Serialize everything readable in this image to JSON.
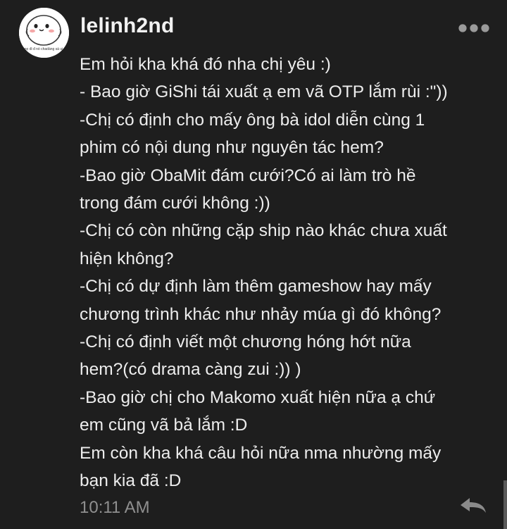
{
  "post": {
    "username": "lelinh2nd",
    "avatar_caption": "nọ đi đ nó chadàng sá ui",
    "icons": {
      "more": "more-options-icon",
      "reply": "reply-arrow-icon"
    },
    "message_lines": [
      "Em hỏi kha khá đó nha chị yêu :)",
      "- Bao giờ GiShi tái xuất ạ em vã OTP lắm rùi :\"))",
      "-Chị có định cho mấy ông bà idol diễn cùng 1",
      "phim có nội dung như nguyên tác hem?",
      "-Bao giờ ObaMit đám cưới?Có ai làm trò hề",
      "trong đám cưới không :))",
      "-Chị có còn những cặp ship nào khác chưa xuất",
      "hiện không?",
      "-Chị có dự định làm thêm gameshow hay mấy",
      "chương trình khác như nhảy múa gì đó không?",
      "-Chị có định viết một chương hóng hớt nữa",
      "hem?(có drama càng zui :)) )",
      "-Bao giờ chị cho Makomo xuất hiện nữa ạ chứ",
      "em cũng vã bả lắm :D",
      "Em còn kha khá câu hỏi nữa nma nhường mấy",
      "bạn kia đã :D"
    ],
    "timestamp": "10:11 AM"
  },
  "colors": {
    "background": "#1e1e1e",
    "text": "#ededed",
    "timestamp": "#8f8f8f",
    "icon": "#9a9a9a"
  }
}
